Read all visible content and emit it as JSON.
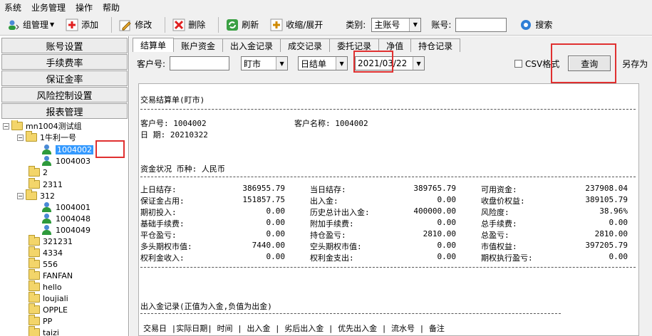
{
  "menu": [
    "系统",
    "业务管理",
    "操作",
    "帮助"
  ],
  "toolbar": {
    "group_mgmt": "组管理",
    "add": "添加",
    "modify": "修改",
    "delete": "删除",
    "refresh": "刷新",
    "collapse": "收缩/展开",
    "type_label": "类别:",
    "type_value": "主账号",
    "account_label": "账号:",
    "account_value": "",
    "search": "搜索"
  },
  "sidebar": {
    "buttons": [
      "账号设置",
      "手续费率",
      "保证金率",
      "风险控制设置",
      "报表管理"
    ]
  },
  "tree": [
    "mn1004测试组",
    "1牛利一号",
    "1004002",
    "1004003",
    "2",
    "2311",
    "312",
    "1004001",
    "1004048",
    "1004049",
    "321231",
    "4334",
    "556",
    "FANFAN",
    "hello",
    "loujiali",
    "OPPLE",
    "PP",
    "taizi"
  ],
  "tabs": [
    "结算单",
    "账户资金",
    "出入金记录",
    "成交记录",
    "委托记录",
    "净值",
    "持仓记录"
  ],
  "query": {
    "client_label": "客户号:",
    "client_value": "",
    "mode": "盯市",
    "period": "日结单",
    "date": "2021/03/22",
    "csv": "CSV格式",
    "query_btn": "查询",
    "save_as": "另存为"
  },
  "report": {
    "title": "交易结算单(盯市)",
    "client_no": "客户号: 1004002",
    "client_name": "客户名称: 1004002",
    "date": "日  期: 20210322",
    "fund_status": "资金状况  币种: 人民币",
    "rows": [
      [
        "上日结存:",
        "386955.79",
        "当日结存:",
        "389765.79",
        "可用资金:",
        "237908.04"
      ],
      [
        "保证金占用:",
        "151857.75",
        "出入金:",
        "0.00",
        "收盘价权益:",
        "389105.79"
      ],
      [
        "期初投入:",
        "0.00",
        "历史总计出入金:",
        "400000.00",
        "风险度:",
        "38.96%"
      ],
      [
        "基础手续费:",
        "0.00",
        "附加手续费:",
        "0.00",
        "总手续费:",
        "0.00"
      ],
      [
        "平仓盈亏:",
        "0.00",
        "持仓盈亏:",
        "2810.00",
        "总盈亏:",
        "2810.00"
      ],
      [
        "多头期权市值:",
        "7440.00",
        "空头期权市值:",
        "0.00",
        "市值权益:",
        "397205.79"
      ],
      [
        "权利金收入:",
        "0.00",
        "权利金支出:",
        "0.00",
        "期权执行盈亏:",
        "0.00"
      ]
    ],
    "io_title": "出入金记录(正值为入金,负值为出金)",
    "io_header": "交易日 |实际日期| 时间   |    出入金    |   劣后出入金   |  优先出入金  | 流水号 | 备注"
  },
  "colors": {
    "highlight": "#e03030",
    "selection": "#3399ff"
  }
}
